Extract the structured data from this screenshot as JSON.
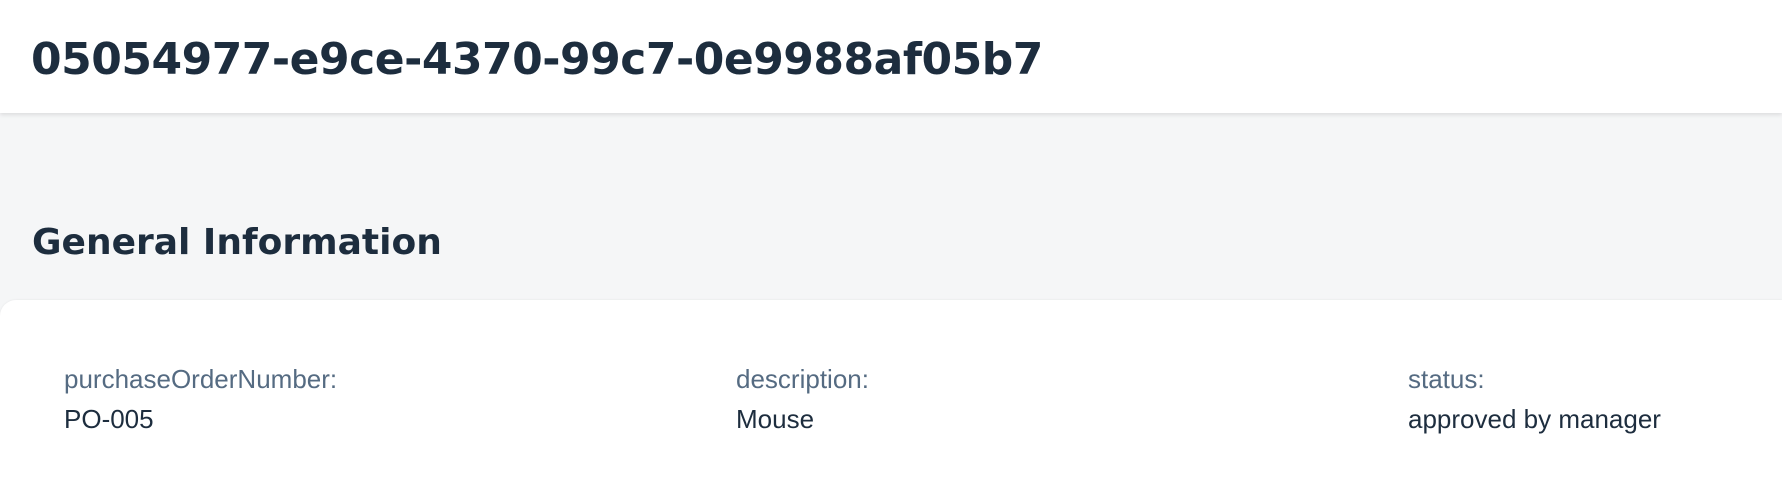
{
  "header": {
    "title": "05054977-e9ce-4370-99c7-0e9988af05b7"
  },
  "section": {
    "title": "General Information"
  },
  "fields": [
    {
      "label": "purchaseOrderNumber:",
      "value": "PO-005"
    },
    {
      "label": "description:",
      "value": "Mouse"
    },
    {
      "label": "status:",
      "value": "approved by manager"
    }
  ],
  "colors": {
    "text_primary": "#1d2d3e",
    "text_label": "#556b82",
    "page_background": "#f5f6f7",
    "surface": "#ffffff"
  }
}
